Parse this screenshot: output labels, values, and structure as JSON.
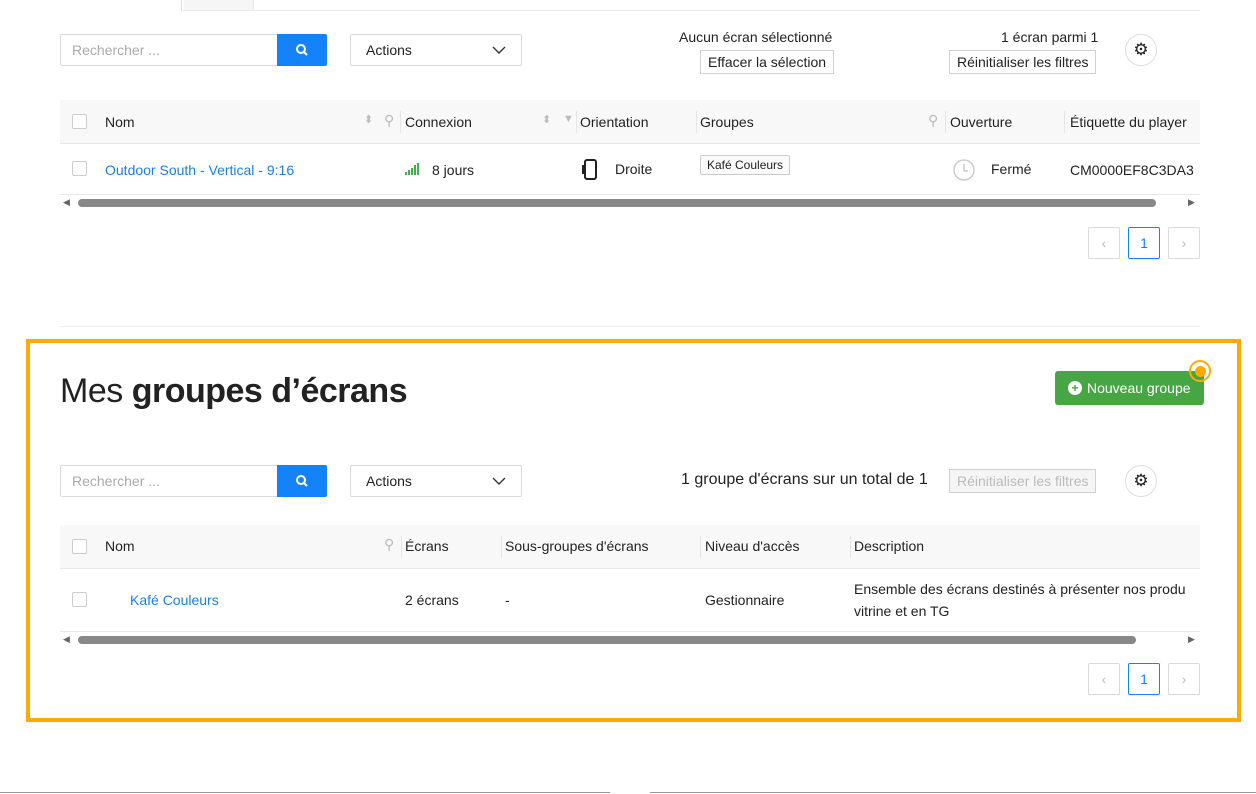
{
  "screens": {
    "search_placeholder": "Rechercher ...",
    "actions_label": "Actions",
    "selection_status": "Aucun écran sélectionné",
    "clear_selection": "Effacer la sélection",
    "count": "1 écran parmi 1",
    "reset_filters": "Réinitialiser les filtres",
    "columns": [
      "Nom",
      "Connexion",
      "Orientation",
      "Groupes",
      "Ouverture",
      "Étiquette du player"
    ],
    "rows": [
      {
        "name": "Outdoor South - Vertical - 9:16",
        "connexion": "8 jours",
        "orientation": "Droite",
        "group": "Kafé Couleurs",
        "opening": "Fermé",
        "player_tag": "CM0000EF8C3DA3"
      }
    ],
    "page": "1"
  },
  "groups": {
    "title_light": "Mes",
    "title_bold": "groupes d’écrans",
    "new_group": "Nouveau groupe",
    "search_placeholder": "Rechercher ...",
    "actions_label": "Actions",
    "count": "1 groupe d'écrans sur un total de 1",
    "reset_filters": "Réinitialiser les filtres",
    "columns": [
      "Nom",
      "Écrans",
      "Sous-groupes d'écrans",
      "Niveau d'accès",
      "Description"
    ],
    "rows": [
      {
        "name": "Kafé Couleurs",
        "screens": "2 écrans",
        "subgroups": "-",
        "access": "Gestionnaire",
        "description_line1": "Ensemble des écrans destinés à présenter nos produ",
        "description_line2": "vitrine et en TG"
      }
    ],
    "page": "1"
  },
  "colors": {
    "accent": "#1482fa",
    "green": "#46a644",
    "highlight": "#fdab00"
  }
}
